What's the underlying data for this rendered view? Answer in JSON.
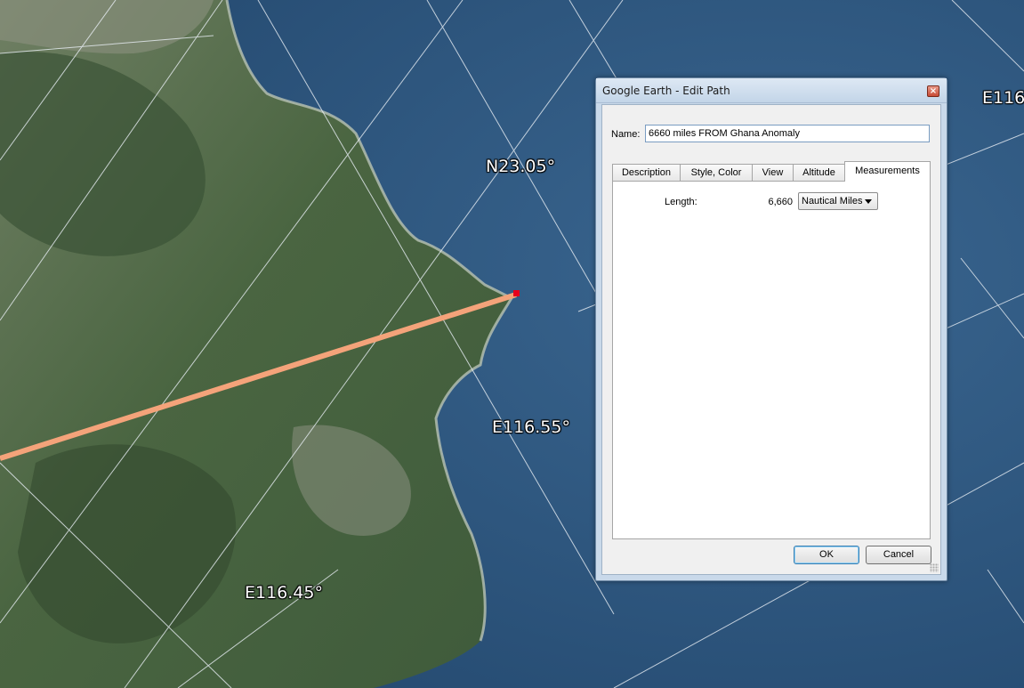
{
  "map": {
    "labels": {
      "n23": "N23.05°",
      "e116_55": "E116.55°",
      "e116_45": "E116.45°",
      "e116_edge": "E116"
    },
    "path_color": "#f4a37a",
    "marker_color": "#e8001c",
    "sea_color": "#2d557c",
    "land_color": "#4f6a45"
  },
  "dialog": {
    "title": "Google Earth - Edit Path",
    "close_glyph": "×",
    "name_label": "Name:",
    "name_value": "6660 miles FROM Ghana Anomaly",
    "tabs": [
      {
        "label": "Description"
      },
      {
        "label": "Style, Color"
      },
      {
        "label": "View"
      },
      {
        "label": "Altitude"
      },
      {
        "label": "Measurements",
        "active": true
      }
    ],
    "measurements": {
      "length_label": "Length:",
      "length_value": "6,660",
      "unit": "Nautical Miles"
    },
    "ok_label": "OK",
    "cancel_label": "Cancel"
  }
}
